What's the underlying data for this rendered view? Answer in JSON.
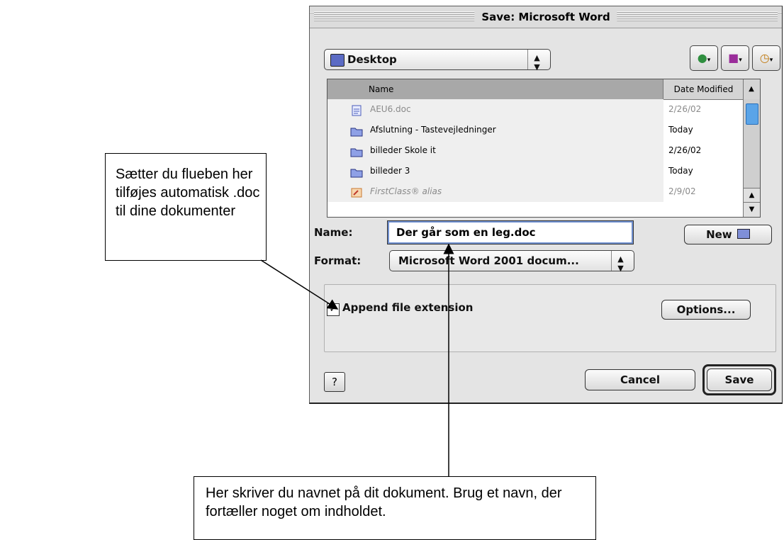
{
  "dialog": {
    "title": "Save: Microsoft Word",
    "location_popup": "Desktop",
    "toolbar_icons": [
      "shortcuts-icon",
      "favorites-icon",
      "recent-icon"
    ],
    "columns": {
      "name": "Name",
      "date": "Date Modified"
    },
    "files": [
      {
        "name": "AEU6.doc",
        "date": "2/26/02",
        "icon": "word-document-icon",
        "dim": true,
        "italic": false
      },
      {
        "name": "Afslutning - Tastevejledninger",
        "date": "Today",
        "icon": "folder-icon",
        "dim": false,
        "italic": false
      },
      {
        "name": "billeder Skole it",
        "date": "2/26/02",
        "icon": "folder-icon",
        "dim": false,
        "italic": false
      },
      {
        "name": "billeder 3",
        "date": "Today",
        "icon": "folder-icon",
        "dim": false,
        "italic": false
      },
      {
        "name": "FirstClass® alias",
        "date": "2/9/02",
        "icon": "alias-icon",
        "dim": true,
        "italic": true
      }
    ],
    "name_label": "Name:",
    "name_value": "Der går som en leg.doc",
    "new_button": "New",
    "format_label": "Format:",
    "format_value": "Microsoft Word 2001 docum...",
    "append_checkbox_label": "Append file extension",
    "append_checked": true,
    "options_button": "Options...",
    "help_button": "?",
    "cancel_button": "Cancel",
    "save_button": "Save"
  },
  "callouts": {
    "left": [
      "Sætter du flueben her",
      "tilføjes automatisk .doc",
      "til dine dokumenter"
    ],
    "bottom": [
      "Her skriver du navnet på dit dokument. Brug et navn, der",
      "fortæller noget om indholdet."
    ]
  }
}
